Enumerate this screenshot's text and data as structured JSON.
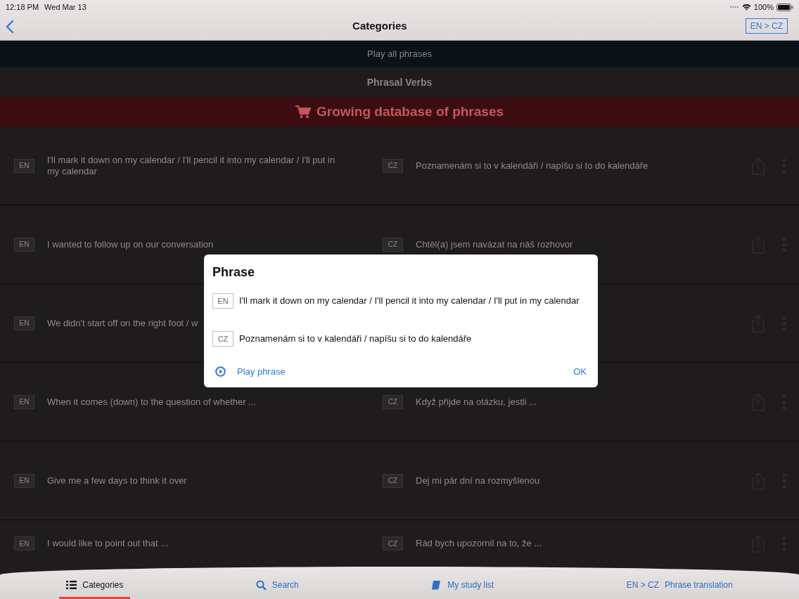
{
  "status_bar": {
    "time": "12:18 PM",
    "date": "Wed Mar 13",
    "battery": "100%"
  },
  "nav": {
    "title": "Categories",
    "language_button": "EN > CZ"
  },
  "play_all": "Play all phrases",
  "category": "Phrasal Verbs",
  "promo": "Growing database of phrases",
  "phrases": [
    {
      "en_label": "EN",
      "en": "I'll mark it down on my calendar / I'll pencil it into my calendar / I'll put in my calendar",
      "cz_label": "CZ",
      "cz": "Poznamenám si to v kalendáři / napíšu si to do kalendáře"
    },
    {
      "en_label": "EN",
      "en": "I wanted to follow up on our conversation",
      "cz_label": "CZ",
      "cz": "Chtěl(a) jsem navázat na náš rozhovor"
    },
    {
      "en_label": "EN",
      "en": "We didn't start off on the right foot / w"
    },
    {
      "en_label": "EN",
      "en": "When it comes (down) to the question of whether ...",
      "cz_label": "CZ",
      "cz": "Když přijde na otázku, jestli ..."
    },
    {
      "en_label": "EN",
      "en": "Give me a few days to think it over",
      "cz_label": "CZ",
      "cz": "Dej mi pár dní na rozmyšlenou"
    },
    {
      "en_label": "EN",
      "en": "I would like to point out that ...",
      "cz_label": "CZ",
      "cz": "Rád bych upozornil na to, že ..."
    }
  ],
  "dialog": {
    "title": "Phrase",
    "lines": [
      {
        "lang": "EN",
        "text": "I'll mark it down on my calendar / I'll pencil it into my calendar / I'll put in my calendar"
      },
      {
        "lang": "CZ",
        "text": "Poznamenám si to v kalendáři / napíšu si to do kalendáře"
      }
    ],
    "play_button": "Play phrase",
    "ok_button": "OK"
  },
  "tabs": [
    {
      "kind": "list",
      "label": "Categories",
      "selected": true
    },
    {
      "kind": "search",
      "label": "Search",
      "selected": false
    },
    {
      "kind": "book",
      "label": "My study list",
      "selected": false
    },
    {
      "kind": "lang",
      "lang": "EN > CZ",
      "label": "Phrase translation",
      "selected": false
    }
  ]
}
